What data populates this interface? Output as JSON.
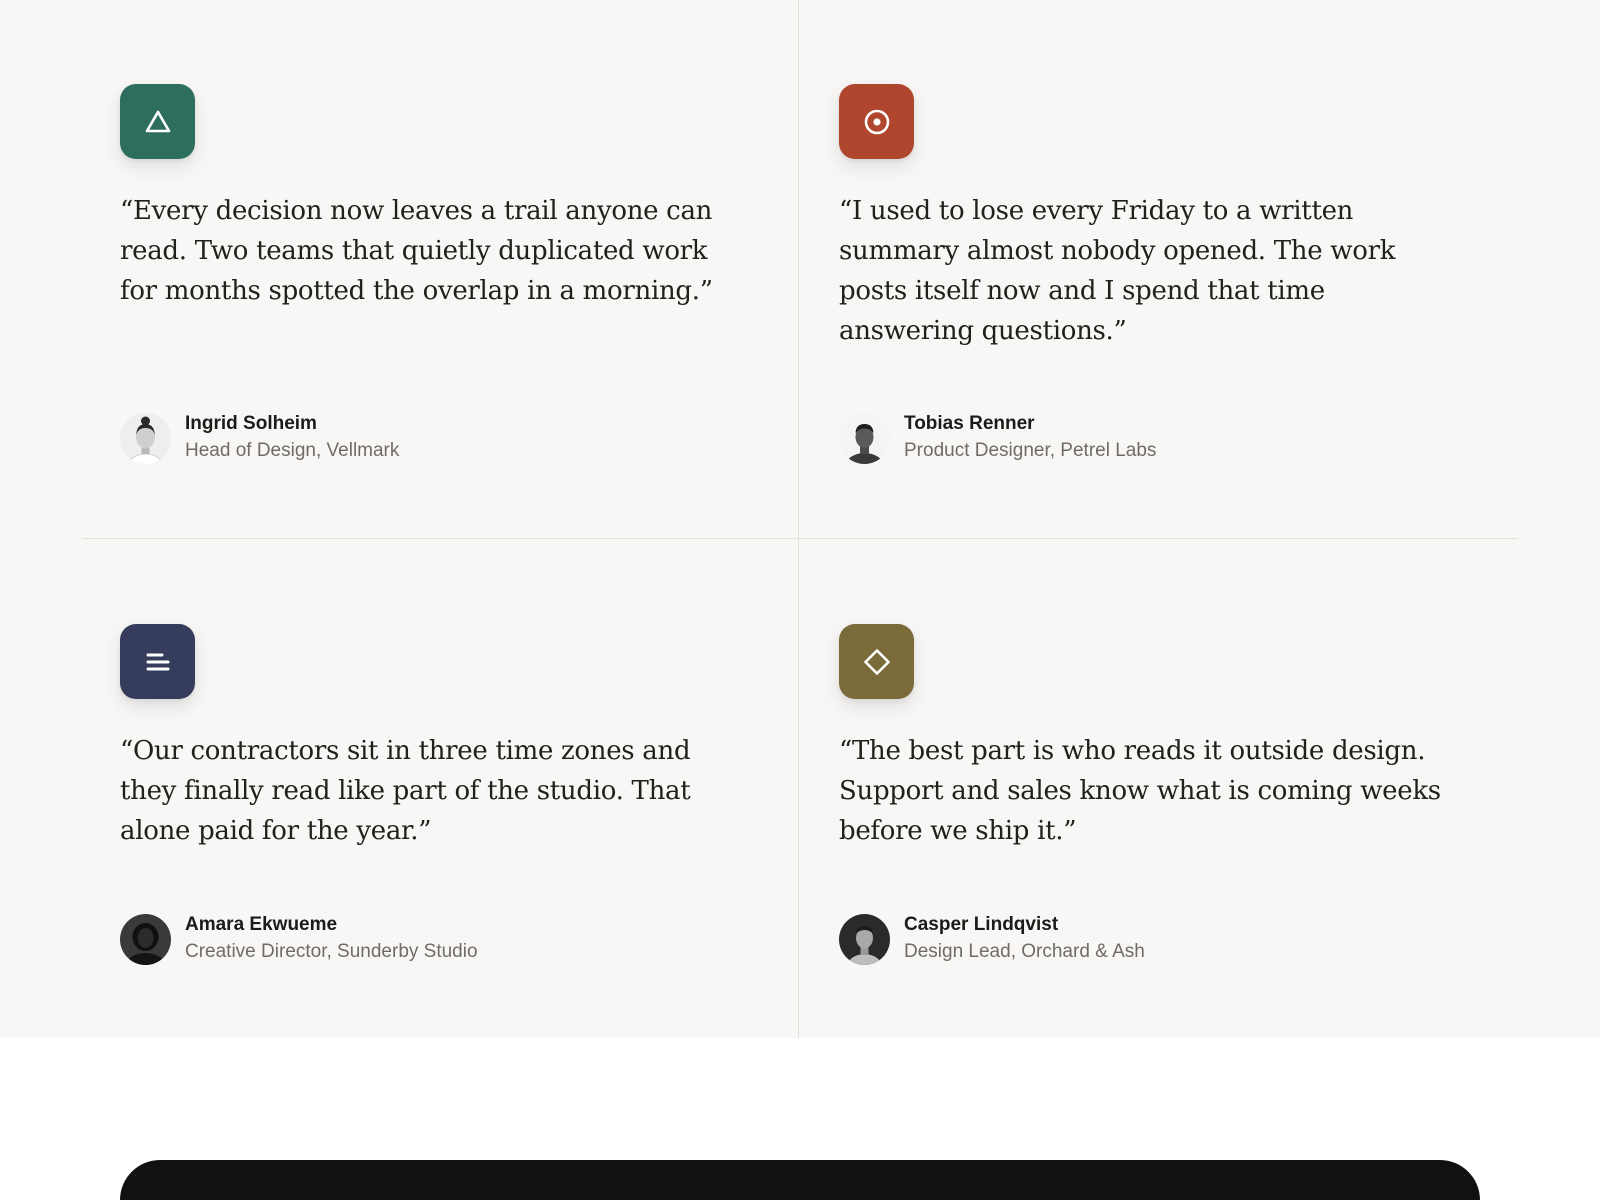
{
  "testimonials": [
    {
      "icon": "triangle-icon",
      "color": "#2e6e5e",
      "quote": "“Every decision now leaves a trail anyone can read. Two teams that quietly duplicated work for months spotted the overlap in a morning.”",
      "name": "Ingrid Solheim",
      "role": "Head of Design, Vellmark"
    },
    {
      "icon": "target-icon",
      "color": "#b1462e",
      "quote": "“I used to lose every Friday to a written summary almost nobody opened. The work posts itself now and I spend that time answering questions.”",
      "name": "Tobias Renner",
      "role": "Product Designer, Petrel Labs"
    },
    {
      "icon": "align-left-icon",
      "color": "#363d5c",
      "quote": "“Our contractors sit in three time zones and they finally read like part of the studio. That alone paid for the year.”",
      "name": "Amara Ekwueme",
      "role": "Creative Director, Sunderby Studio"
    },
    {
      "icon": "diamond-icon",
      "color": "#7b6b3a",
      "quote": "“The best part is who reads it outside design. Support and sales know what is coming weeks before we ship it.”",
      "name": "Casper Lindqvist",
      "role": "Design Lead, Orchard & Ash"
    }
  ]
}
